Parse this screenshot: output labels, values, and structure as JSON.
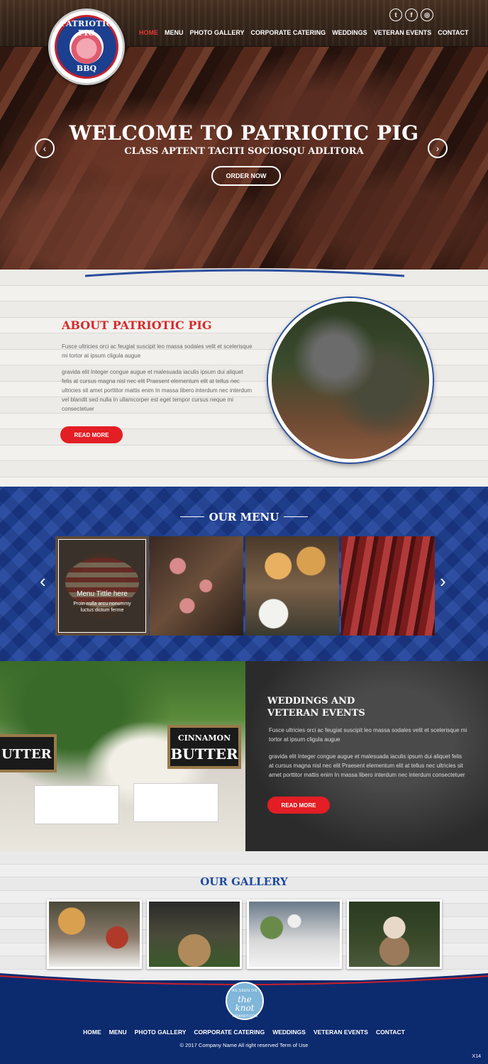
{
  "header": {
    "logo": {
      "top_text": "PATRIOTIC PIG",
      "bottom_text": "BBQ"
    },
    "nav": [
      "HOME",
      "MENU",
      "PHOTO GALLERY",
      "CORPORATE CATERING",
      "WEDDINGS",
      "VETERAN EVENTS",
      "CONTACT"
    ],
    "active_nav": "HOME",
    "social_icons": [
      "twitter-icon",
      "facebook-icon",
      "instagram-icon"
    ]
  },
  "hero": {
    "title": "WELCOME TO PATRIOTIC PIG",
    "subtitle": "CLASS APTENT TACITI SOCIOSQU ADLITORA",
    "button": "ORDER NOW"
  },
  "about": {
    "title": "ABOUT PATRIOTIC PIG",
    "p1": "Fusce ultricies orci ac feugiat suscipit leo massa sodales velit et scelerisque mi tortor at ipsum cligula augue",
    "p2": "gravida elit Integer congue augue et malesuada iaculis ipsum dui aliquet felis at cursus magna nisl nec elit Praesent elementum elit at tellus nec ultricies sit amet porttitor mattis enim In massa libero interdum nec interdum vel blandit sed nulla In ullamcorper est eget tempor cursus neque mi consectetuer",
    "button": "READ MORE"
  },
  "menu": {
    "title": "OUR MENU",
    "card_title": "Menu Tittle here",
    "card_desc": "Proin nulla arcu nonummy luctus dictum ferme"
  },
  "weddings": {
    "title_line1": "WEDDINGS AND",
    "title_line2": "VETERAN EVENTS",
    "p1": "Fusce ultricies orci ac feugiat suscipit leo massa sodales velit et scelerisque mi tortor at ipsum cligula augue",
    "p2": "gravida elit Integer congue augue et malesuada iaculis ipsum dui aliquet felis at cursus magna nisl nec elit Praesent elementum elit at tellus nec ultricies sit amet porttitor mattis enim In massa libero interdum nec interdum consectetuer",
    "button": "READ MORE",
    "sign_left": "UTTER",
    "sign_right_1": "CINNAMON",
    "sign_right_2": "BUTTER"
  },
  "gallery": {
    "title": "OUR GALLERY"
  },
  "footer": {
    "badge": {
      "top": "AS SEEN ON",
      "main": "the knot",
      "bottom": "THEKNOT.COM"
    },
    "nav": [
      "HOME",
      "MENU",
      "PHOTO GALLERY",
      "CORPORATE CATERING",
      "WEDDINGS",
      "VETERAN EVENTS",
      "CONTACT"
    ],
    "copyright": "© 2017 Company Name  All right reserved  Term of Use",
    "tag": "X14"
  }
}
